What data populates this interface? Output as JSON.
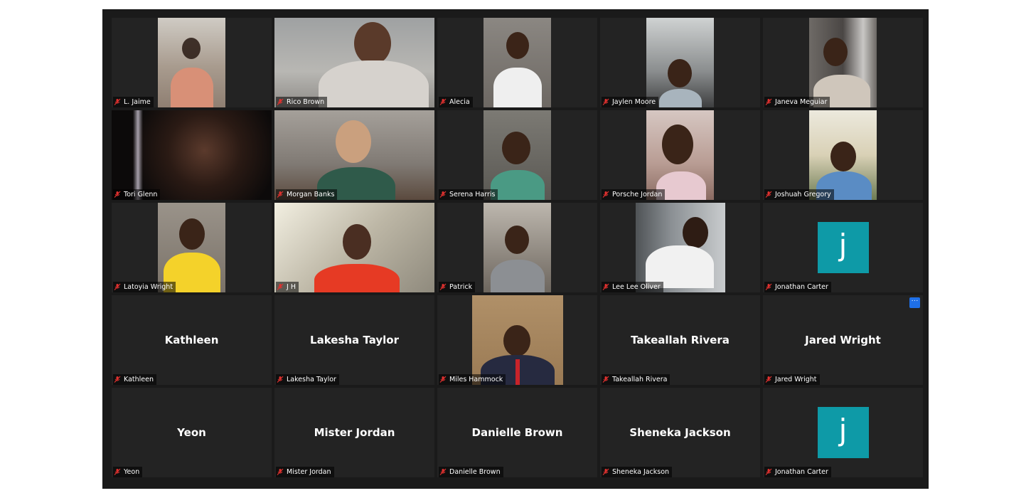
{
  "participants": [
    {
      "label": "L. Jaime",
      "kind": "video"
    },
    {
      "label": "Rico Brown",
      "kind": "video"
    },
    {
      "label": "Alecia",
      "kind": "video"
    },
    {
      "label": "Jaylen Moore",
      "kind": "video"
    },
    {
      "label": "Janeva Meguiar",
      "kind": "video"
    },
    {
      "label": "Tori Glenn",
      "kind": "video"
    },
    {
      "label": "Morgan Banks",
      "kind": "video"
    },
    {
      "label": "Serena Harris",
      "kind": "video"
    },
    {
      "label": "Porsche Jordan",
      "kind": "video"
    },
    {
      "label": "Joshuah Gregory",
      "kind": "video"
    },
    {
      "label": "Latoyia Wright",
      "kind": "video"
    },
    {
      "label": "J H",
      "kind": "video"
    },
    {
      "label": "Patrick",
      "kind": "video"
    },
    {
      "label": "Lee Lee Oliver",
      "kind": "video"
    },
    {
      "label": "Jonathan Carter",
      "kind": "avatar",
      "avatar_letter": "j"
    },
    {
      "label": "Kathleen",
      "kind": "name",
      "display_name": "Kathleen"
    },
    {
      "label": "Lakesha Taylor",
      "kind": "name",
      "display_name": "Lakesha Taylor"
    },
    {
      "label": "Miles Hammock",
      "kind": "video"
    },
    {
      "label": "Takeallah Rivera",
      "kind": "name",
      "display_name": "Takeallah Rivera"
    },
    {
      "label": "Jared Wright",
      "kind": "name",
      "display_name": "Jared Wright"
    },
    {
      "label": "Yeon",
      "kind": "name",
      "display_name": "Yeon"
    },
    {
      "label": "Mister Jordan",
      "kind": "name",
      "display_name": "Mister Jordan"
    },
    {
      "label": "Danielle Brown",
      "kind": "name",
      "display_name": "Danielle Brown"
    },
    {
      "label": "Sheneka Jackson",
      "kind": "name",
      "display_name": "Sheneka Jackson"
    },
    {
      "label": "Jonathan Carter",
      "kind": "avatar",
      "avatar_letter": "j"
    }
  ],
  "more_button_label": "···",
  "colors": {
    "background": "#1a1a1a",
    "tile": "#232323",
    "avatar": "#0e9aa7",
    "muted_mic": "#e0312f",
    "more_button": "#1e6fe8"
  }
}
